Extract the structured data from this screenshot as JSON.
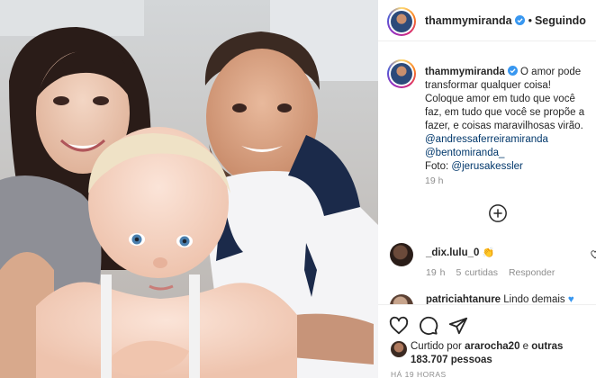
{
  "post": {
    "username": "thammymiranda",
    "follow_state": "Seguindo",
    "photo_alt": "",
    "caption_lines": [
      "O amor pode transformar qualquer coisa! Coloque amor em tudo que você faz, em tudo que você se propõe a fazer, e coisas maravilhosas virão."
    ],
    "mentions": [
      "@andressaferreiramiranda",
      "@bentomiranda_"
    ],
    "credit_prefix": "Foto:",
    "credit_handle": "@jerusakessler",
    "caption_time": "19 h"
  },
  "comments": [
    {
      "username": "_dix.lulu_0",
      "emoji": "👏",
      "time": "19 h",
      "likes": "5 curtidas",
      "reply": "Responder"
    },
    {
      "username": "patriciahtanure",
      "text": "Lindo demais"
    }
  ],
  "likes": {
    "liked_by_prefix": "Curtido por",
    "liked_by_user": "ararocha20",
    "and": "e",
    "others_text": "outras 183.707 pessoas"
  },
  "timestamp": "HÁ 19 HORAS",
  "icons": {
    "header_avatar": "profile-avatar-icon",
    "verified": "verified-badge-icon",
    "add_comment": "plus-circle-icon",
    "like": "heart-icon",
    "comment": "comment-bubble-icon",
    "share": "paper-plane-icon"
  },
  "colors": {
    "verified_blue": "#3897f0",
    "mention_blue": "#00376b",
    "muted_gray": "#8e8e8e"
  }
}
